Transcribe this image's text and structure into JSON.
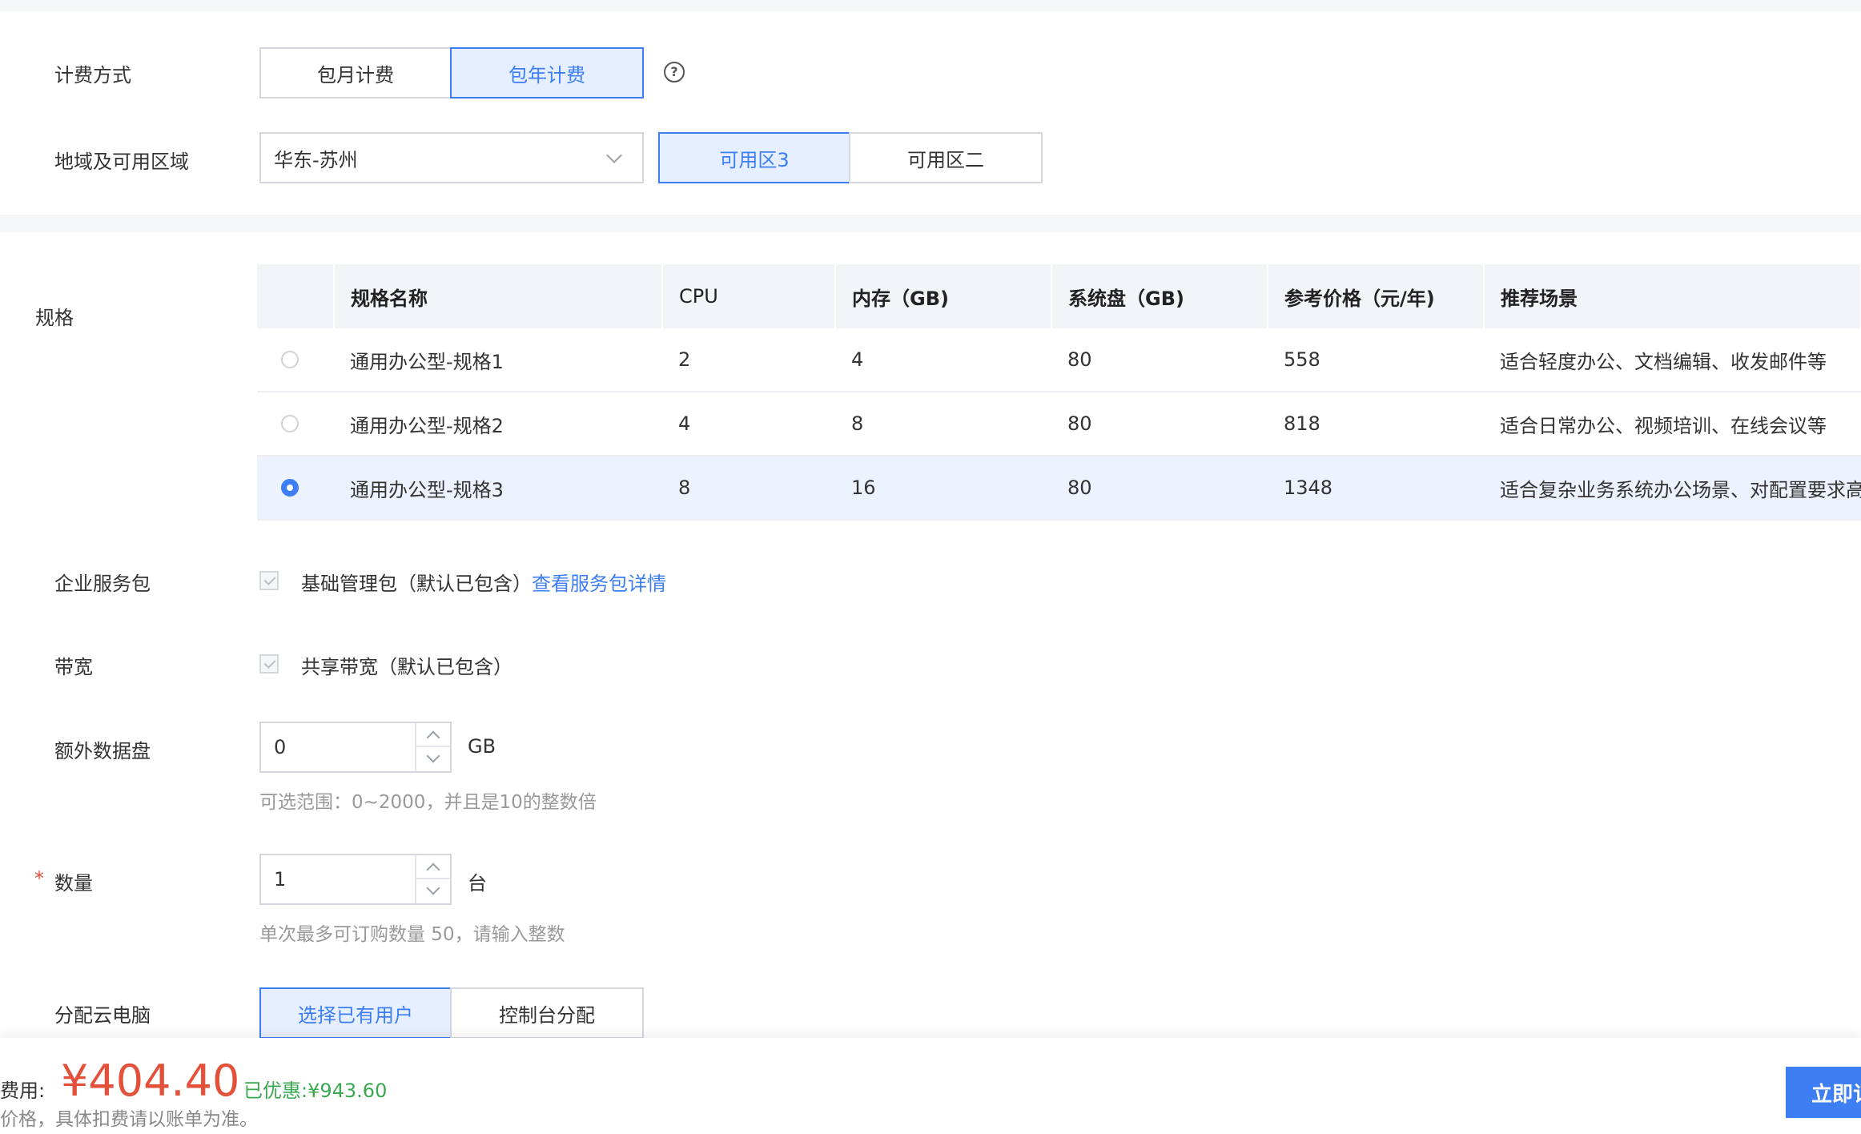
{
  "billing": {
    "label": "计费方式",
    "options": [
      "包月计费",
      "包年计费"
    ],
    "selected": "包年计费",
    "help_icon": "question-circle-icon"
  },
  "region": {
    "label": "地域及可用区域",
    "value": "华东-苏州",
    "zones": [
      "可用区3",
      "可用区二"
    ],
    "selected_zone": "可用区3"
  },
  "spec": {
    "label": "规格",
    "columns": [
      "",
      "规格名称",
      "CPU",
      "内存（GB)",
      "系统盘（GB)",
      "参考价格（元/年)",
      "推荐场景"
    ],
    "rows": [
      {
        "name": "通用办公型-规格1",
        "cpu": "2",
        "mem": "4",
        "disk": "80",
        "price": "558",
        "scene": "适合轻度办公、文档编辑、收发邮件等",
        "selected": false
      },
      {
        "name": "通用办公型-规格2",
        "cpu": "4",
        "mem": "8",
        "disk": "80",
        "price": "818",
        "scene": "适合日常办公、视频培训、在线会议等",
        "selected": false
      },
      {
        "name": "通用办公型-规格3",
        "cpu": "8",
        "mem": "16",
        "disk": "80",
        "price": "1348",
        "scene": "适合复杂业务系统办公场景、对配置要求高",
        "selected": true
      }
    ]
  },
  "service_pack": {
    "label": "企业服务包",
    "text": "基础管理包（默认已包含）",
    "link": "查看服务包详情"
  },
  "bandwidth": {
    "label": "带宽",
    "text": "共享带宽（默认已包含）"
  },
  "data_disk": {
    "label": "额外数据盘",
    "value": "0",
    "unit": "GB",
    "hint": "可选范围：0~2000，并且是10的整数倍"
  },
  "quantity": {
    "required_mark": "*",
    "label": "数量",
    "value": "1",
    "unit": "台",
    "hint": "单次最多可订购数量 50，请输入整数"
  },
  "assign": {
    "label": "分配云电脑",
    "options": [
      "选择已有用户",
      "控制台分配"
    ],
    "selected": "选择已有用户"
  },
  "footer": {
    "fee_label": "费用:",
    "price": "¥404.40",
    "discount_label": "已优惠:",
    "discount_value": "¥943.60",
    "note": "价格，具体扣费请以账单为准。",
    "order_button": "立即订"
  },
  "colors": {
    "accent": "#3d7ef5",
    "price": "#e4513b",
    "discount": "#3aa852"
  }
}
